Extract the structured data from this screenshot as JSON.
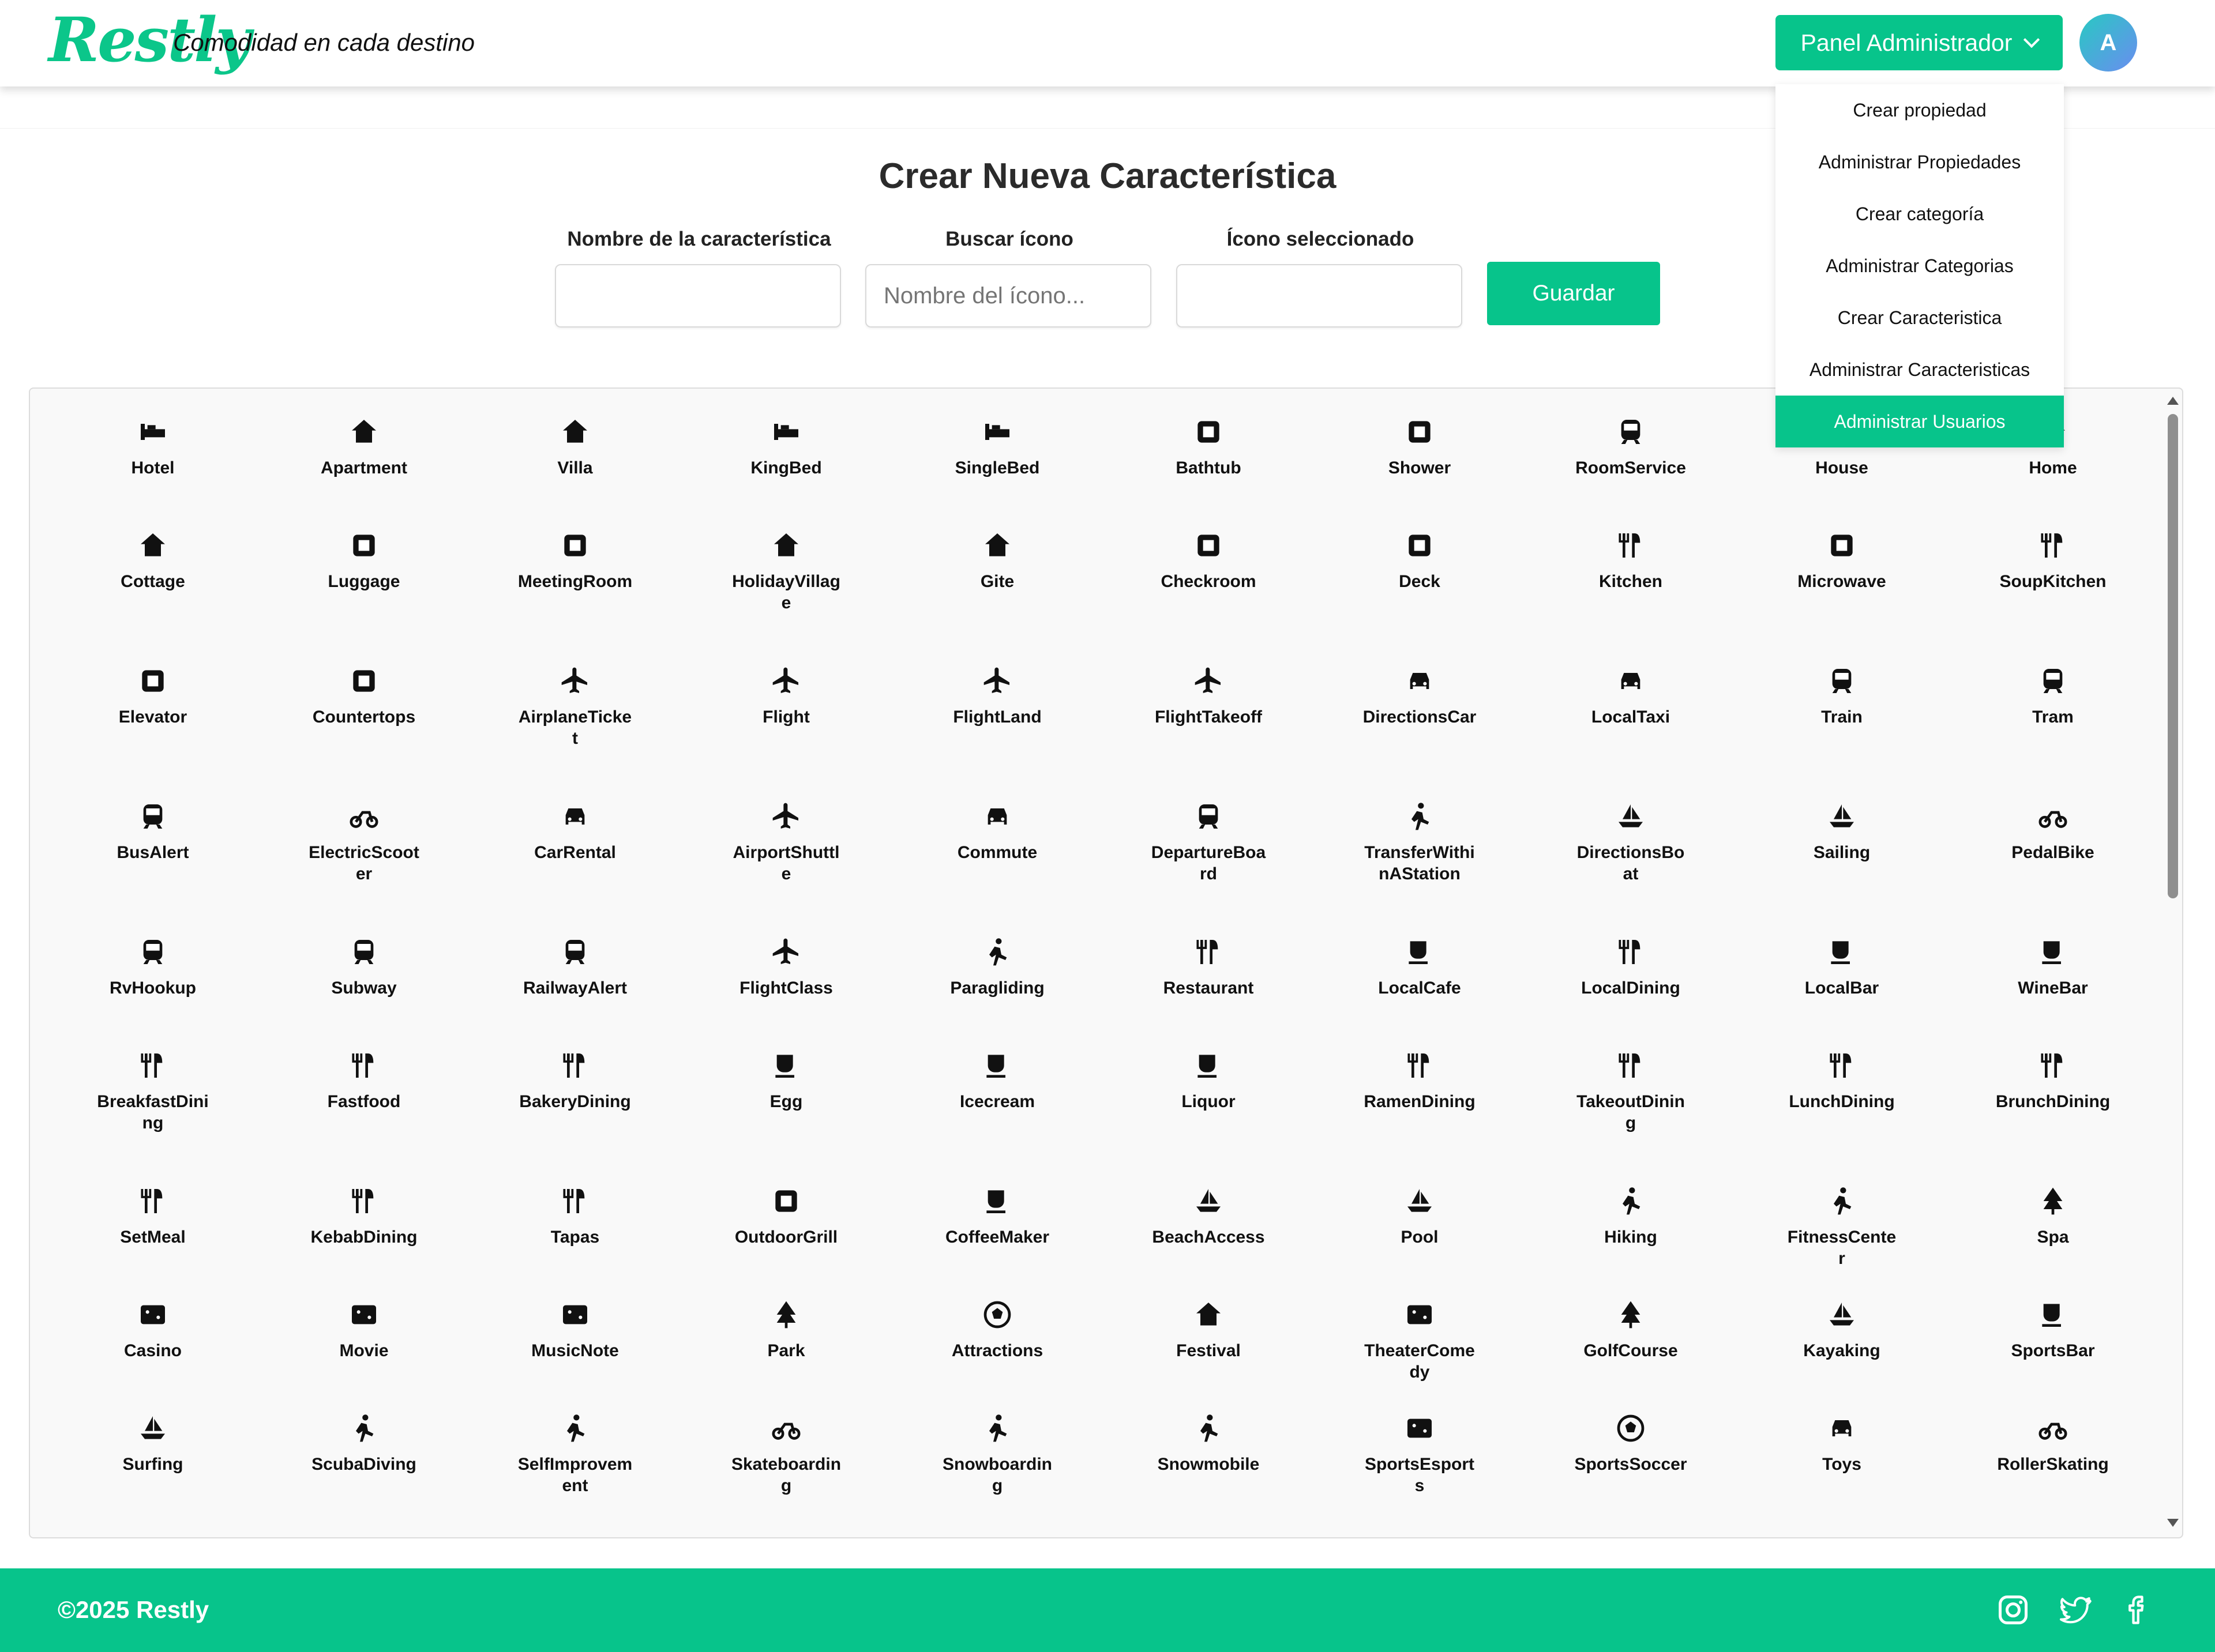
{
  "header": {
    "logo": "Restly",
    "tagline": "Comodidad en cada destino",
    "admin_button": "Panel Administrador",
    "avatar_initial": "A"
  },
  "dropdown": {
    "items": [
      {
        "label": "Crear propiedad",
        "active": false
      },
      {
        "label": "Administrar Propiedades",
        "active": false
      },
      {
        "label": "Crear categoría",
        "active": false
      },
      {
        "label": "Administrar Categorias",
        "active": false
      },
      {
        "label": "Crear Caracteristica",
        "active": false
      },
      {
        "label": "Administrar Caracteristicas",
        "active": false
      },
      {
        "label": "Administrar Usuarios",
        "active": true
      }
    ]
  },
  "form": {
    "title": "Crear Nueva Característica",
    "name_label": "Nombre de la característica",
    "name_value": "",
    "search_label": "Buscar ícono",
    "search_placeholder": "Nombre del ícono...",
    "selected_label": "Ícono seleccionado",
    "selected_value": "",
    "save_button": "Guardar"
  },
  "icons": [
    [
      "Hotel",
      "Apartment",
      "Villa",
      "KingBed",
      "SingleBed",
      "Bathtub",
      "Shower",
      "RoomService",
      "House",
      "Home"
    ],
    [
      "Cottage",
      "Luggage",
      "MeetingRoom",
      "HolidayVillage",
      "Gite",
      "Checkroom",
      "Deck",
      "Kitchen",
      "Microwave",
      "SoupKitchen"
    ],
    [
      "Elevator",
      "Countertops",
      "AirplaneTicket",
      "Flight",
      "FlightLand",
      "FlightTakeoff",
      "DirectionsCar",
      "LocalTaxi",
      "Train",
      "Tram"
    ],
    [
      "BusAlert",
      "ElectricScooter",
      "CarRental",
      "AirportShuttle",
      "Commute",
      "DepartureBoard",
      "TransferWithinAStation",
      "DirectionsBoat",
      "Sailing",
      "PedalBike"
    ],
    [
      "RvHookup",
      "Subway",
      "RailwayAlert",
      "FlightClass",
      "Paragliding",
      "Restaurant",
      "LocalCafe",
      "LocalDining",
      "LocalBar",
      "WineBar"
    ],
    [
      "BreakfastDining",
      "Fastfood",
      "BakeryDining",
      "Egg",
      "Icecream",
      "Liquor",
      "RamenDining",
      "TakeoutDining",
      "LunchDining",
      "BrunchDining"
    ],
    [
      "SetMeal",
      "KebabDining",
      "Tapas",
      "OutdoorGrill",
      "CoffeeMaker",
      "BeachAccess",
      "Pool",
      "Hiking",
      "FitnessCenter",
      "Spa"
    ],
    [
      "Casino",
      "Movie",
      "MusicNote",
      "Park",
      "Attractions",
      "Festival",
      "TheaterComedy",
      "GolfCourse",
      "Kayaking",
      "SportsBar"
    ],
    [
      "Surfing",
      "ScubaDiving",
      "SelfImprovement",
      "Skateboarding",
      "Snowboarding",
      "Snowmobile",
      "SportsEsports",
      "SportsSoccer",
      "Toys",
      "RollerSkating"
    ]
  ],
  "footer": {
    "copyright": "©2025 Restly",
    "social": [
      "instagram-icon",
      "twitter-icon",
      "facebook-icon"
    ]
  },
  "colors": {
    "brand": "#07c48b",
    "icon": "#111111"
  }
}
